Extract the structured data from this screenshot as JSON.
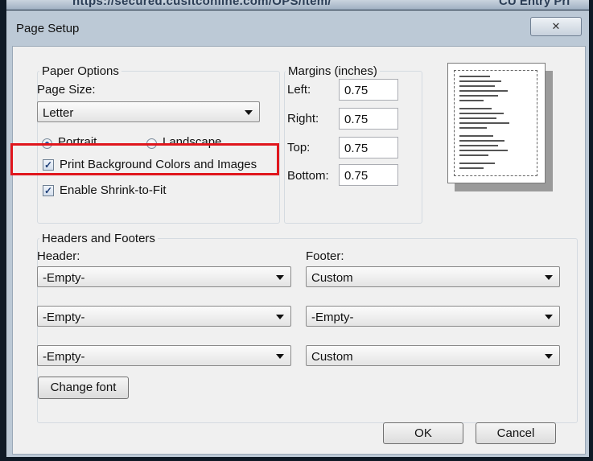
{
  "background_window": {
    "url_fragment": "https://secured.cusitconline.com/OPS/item/",
    "right_fragment": "CU Entry Pri"
  },
  "dialog": {
    "title": "Page Setup",
    "close_glyph": "✕"
  },
  "paper_options": {
    "group_label": "Paper Options",
    "page_size_label": "Page Size:",
    "page_size_value": "Letter",
    "portrait_label": "Portrait",
    "landscape_label": "Landscape",
    "orientation_selected": "Portrait",
    "print_background_label": "Print Background Colors and Images",
    "print_background_checked": true,
    "shrink_to_fit_label": "Enable Shrink-to-Fit",
    "shrink_to_fit_checked": true
  },
  "margins": {
    "group_label": "Margins (inches)",
    "left_label": "Left:",
    "left_value": "0.75",
    "right_label": "Right:",
    "right_value": "0.75",
    "top_label": "Top:",
    "top_value": "0.75",
    "bottom_label": "Bottom:",
    "bottom_value": "0.75"
  },
  "headers_footers": {
    "group_label": "Headers and Footers",
    "header_label": "Header:",
    "footer_label": "Footer:",
    "header_values": [
      "-Empty-",
      "-Empty-",
      "-Empty-"
    ],
    "footer_values": [
      "Custom",
      "-Empty-",
      "Custom"
    ],
    "change_font_label": "Change font"
  },
  "buttons": {
    "ok_label": "OK",
    "cancel_label": "Cancel"
  },
  "colors": {
    "highlight": "#e0161d",
    "dialog_frame": "#bcc9d6",
    "client_bg": "#f0f0f0"
  }
}
